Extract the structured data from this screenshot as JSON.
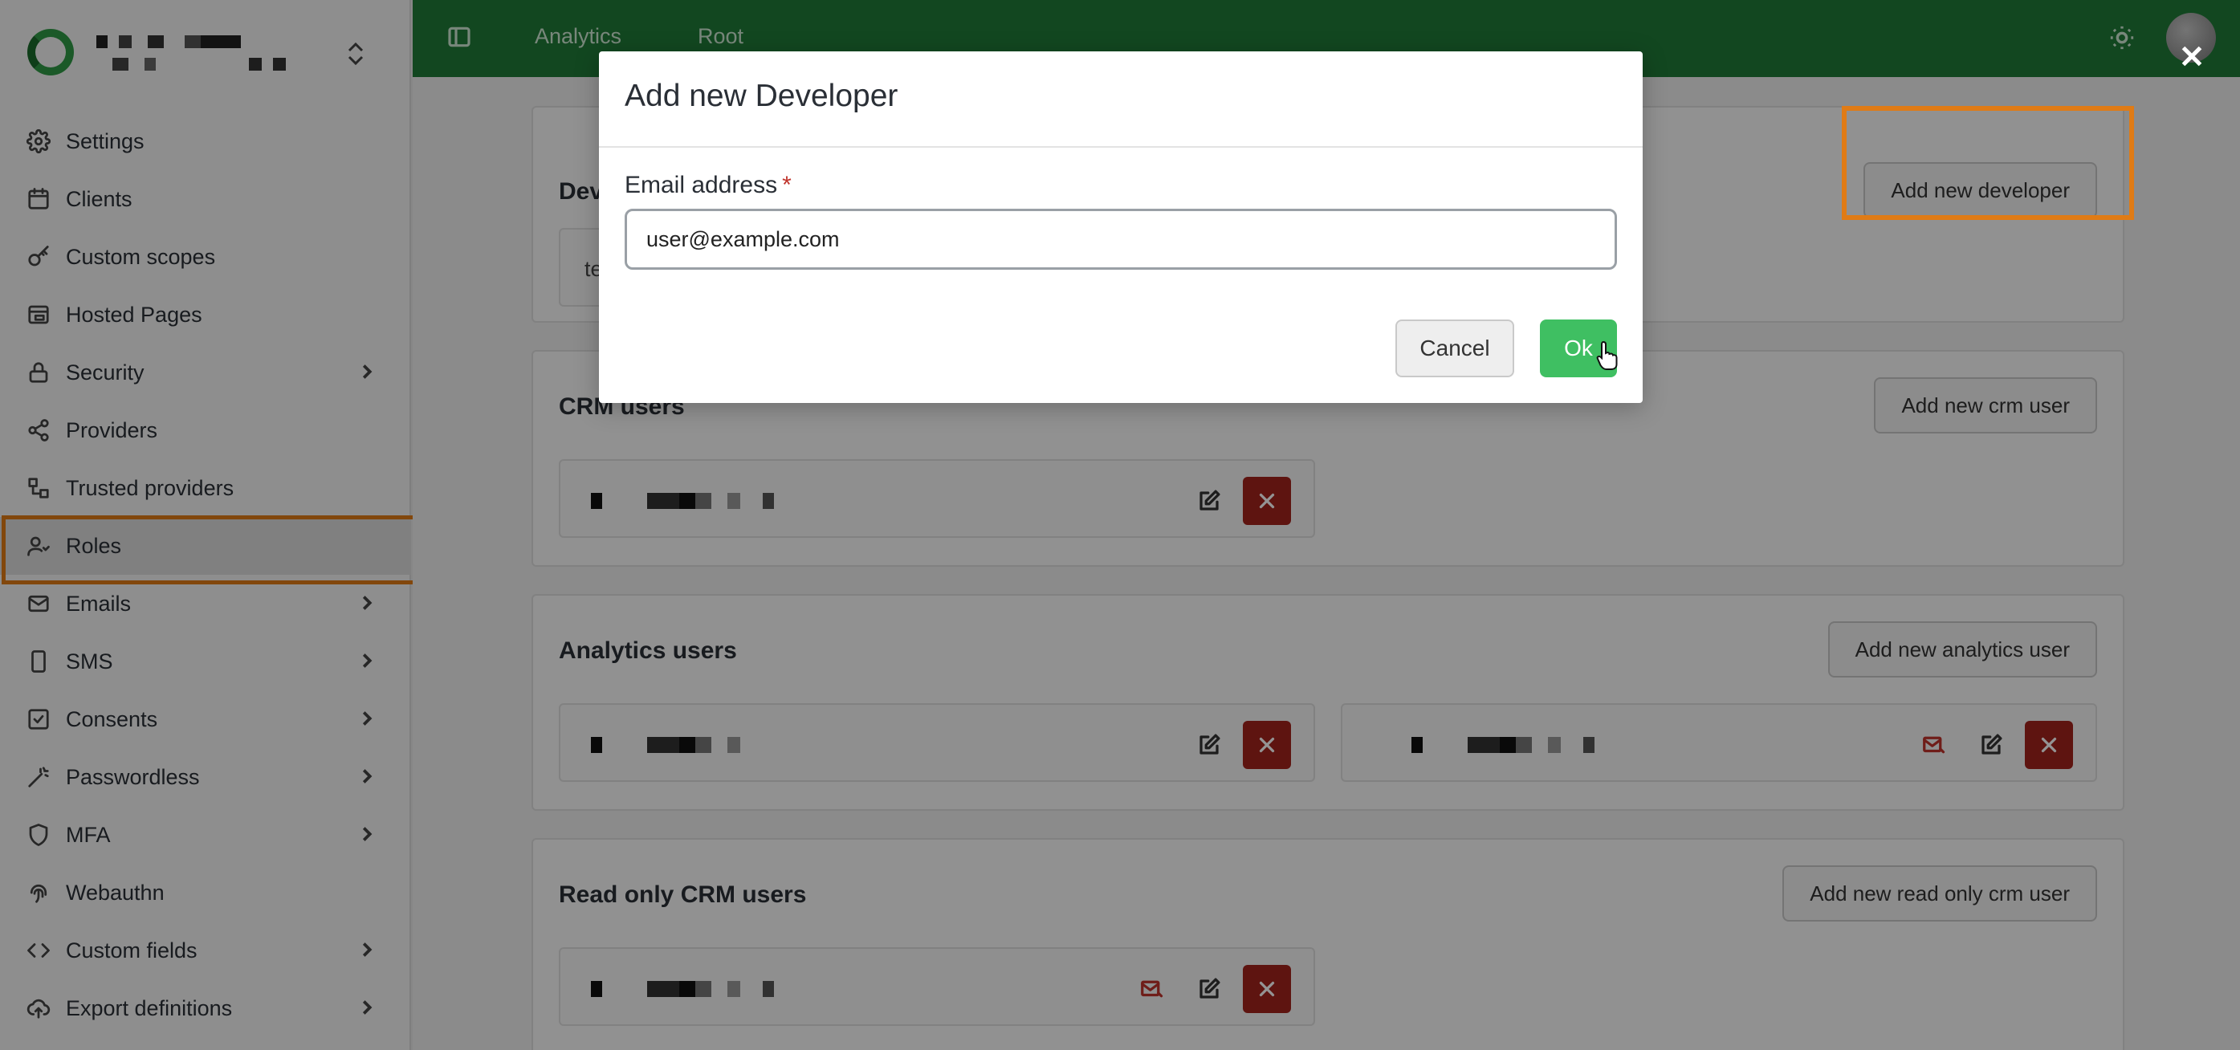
{
  "sidebar": {
    "items": [
      {
        "label": "Settings",
        "icon": "gear-icon",
        "has_children": false
      },
      {
        "label": "Clients",
        "icon": "calendar-icon",
        "has_children": false
      },
      {
        "label": "Custom scopes",
        "icon": "key-icon",
        "has_children": false
      },
      {
        "label": "Hosted Pages",
        "icon": "browser-icon",
        "has_children": false
      },
      {
        "label": "Security",
        "icon": "lock-icon",
        "has_children": true
      },
      {
        "label": "Providers",
        "icon": "share-icon",
        "has_children": false
      },
      {
        "label": "Trusted providers",
        "icon": "flow-icon",
        "has_children": false
      },
      {
        "label": "Roles",
        "icon": "user-roles-icon",
        "has_children": false,
        "active": true
      },
      {
        "label": "Emails",
        "icon": "mail-icon",
        "has_children": true
      },
      {
        "label": "SMS",
        "icon": "phone-icon",
        "has_children": true
      },
      {
        "label": "Consents",
        "icon": "check-square-icon",
        "has_children": true
      },
      {
        "label": "Passwordless",
        "icon": "magic-wand-icon",
        "has_children": true
      },
      {
        "label": "MFA",
        "icon": "shield-icon",
        "has_children": true
      },
      {
        "label": "Webauthn",
        "icon": "fingerprint-icon",
        "has_children": false
      },
      {
        "label": "Custom fields",
        "icon": "code-icon",
        "has_children": true
      },
      {
        "label": "Export definitions",
        "icon": "cloud-upload-icon",
        "has_children": true
      }
    ]
  },
  "topbar": {
    "breadcrumbs": [
      "Analytics",
      "Root"
    ]
  },
  "main": {
    "developers": {
      "title_partial": "Dev",
      "tile_partial": "te",
      "add_button": "Add new developer"
    },
    "crm_users": {
      "title": "CRM users",
      "add_button": "Add new crm user"
    },
    "analytics_users": {
      "title": "Analytics users",
      "add_button": "Add new analytics user"
    },
    "readonly_crm_users": {
      "title": "Read only CRM users",
      "add_button": "Add new read only crm user"
    }
  },
  "modal": {
    "title": "Add new Developer",
    "email_label": "Email address",
    "required_mark": "*",
    "email_value": "user@example.com",
    "cancel_label": "Cancel",
    "ok_label": "Ok"
  },
  "colors": {
    "topbar": "#1f7a37",
    "highlight": "#e07b15",
    "ok_button": "#3fbf62",
    "delete_button": "#a3241d"
  }
}
